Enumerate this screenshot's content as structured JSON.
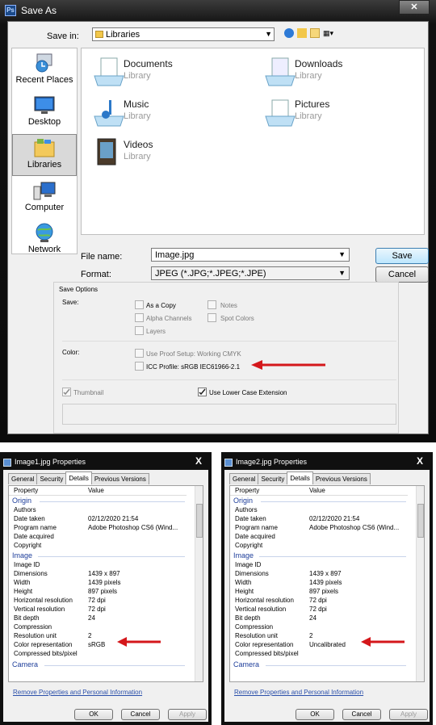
{
  "save_as": {
    "title": "Save As",
    "save_in_label": "Save in:",
    "save_in_value": "Libraries",
    "places": [
      {
        "label": "Recent Places",
        "icon": "recent-places-icon"
      },
      {
        "label": "Desktop",
        "icon": "desktop-icon"
      },
      {
        "label": "Libraries",
        "icon": "libraries-icon",
        "selected": true
      },
      {
        "label": "Computer",
        "icon": "computer-icon"
      },
      {
        "label": "Network",
        "icon": "network-icon"
      }
    ],
    "libraries": [
      {
        "name": "Documents",
        "sub": "Library",
        "icon": "documents-library-icon"
      },
      {
        "name": "Downloads",
        "sub": "Library",
        "icon": "downloads-library-icon"
      },
      {
        "name": "Music",
        "sub": "Library",
        "icon": "music-library-icon"
      },
      {
        "name": "Pictures",
        "sub": "Library",
        "icon": "pictures-library-icon"
      },
      {
        "name": "Videos",
        "sub": "Library",
        "icon": "videos-library-icon"
      }
    ],
    "file_name_label": "File name:",
    "file_name_value": "Image.jpg",
    "format_label": "Format:",
    "format_value": "JPEG (*.JPG;*.JPEG;*.JPE)",
    "save_button": "Save",
    "cancel_button": "Cancel",
    "save_options": {
      "heading": "Save Options",
      "save_label": "Save:",
      "as_a_copy": "As a Copy",
      "notes": "Notes",
      "alpha_channels": "Alpha Channels",
      "spot_colors": "Spot Colors",
      "layers": "Layers",
      "color_label": "Color:",
      "use_proof_setup": "Use Proof Setup:  Working CMYK",
      "icc_profile": "ICC Profile:  sRGB IEC61966-2.1",
      "thumbnail": "Thumbnail",
      "lower_case_ext": "Use Lower Case Extension"
    }
  },
  "prop_common": {
    "tabs": [
      "General",
      "Security",
      "Details",
      "Previous Versions"
    ],
    "col_property": "Property",
    "col_value": "Value",
    "group_origin": "Origin",
    "group_image": "Image",
    "group_camera": "Camera",
    "keys": {
      "authors": "Authors",
      "date_taken": "Date taken",
      "program_name": "Program name",
      "date_acquired": "Date acquired",
      "copyright": "Copyright",
      "image_id": "Image ID",
      "dimensions": "Dimensions",
      "width": "Width",
      "height": "Height",
      "h_res": "Horizontal resolution",
      "v_res": "Vertical resolution",
      "bit_depth": "Bit depth",
      "compression": "Compression",
      "res_unit": "Resolution unit",
      "color_rep": "Color representation",
      "comp_bits": "Compressed bits/pixel"
    },
    "link": "Remove Properties and Personal Information",
    "ok": "OK",
    "cancel": "Cancel",
    "apply": "Apply",
    "close": "X"
  },
  "prop1": {
    "title": "Image1.jpg Properties",
    "date_taken": "02/12/2020 21:54",
    "program_name": "Adobe Photoshop CS6 (Wind...",
    "dimensions": "1439 x 897",
    "width": "1439 pixels",
    "height": "897 pixels",
    "h_res": "72 dpi",
    "v_res": "72 dpi",
    "bit_depth": "24",
    "res_unit": "2",
    "color_rep": "sRGB"
  },
  "prop2": {
    "title": "Image2.jpg Properties",
    "date_taken": "02/12/2020 21:54",
    "program_name": "Adobe Photoshop CS6 (Wind...",
    "dimensions": "1439 x 897",
    "width": "1439 pixels",
    "height": "897 pixels",
    "h_res": "72 dpi",
    "v_res": "72 dpi",
    "bit_depth": "24",
    "res_unit": "2",
    "color_rep": "Uncalibrated"
  },
  "colors": {
    "arrow": "#d4171b",
    "link": "#2a4faa",
    "group": "#1e3e9a"
  }
}
